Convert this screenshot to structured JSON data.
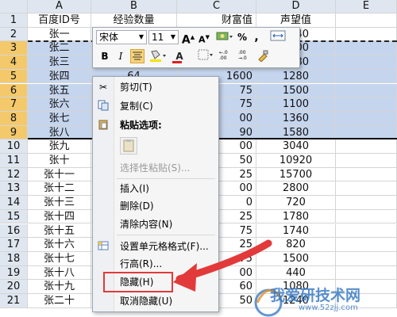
{
  "columns": {
    "A": "A",
    "B": "B",
    "C": "C",
    "D": "D",
    "E": "E"
  },
  "header_row": {
    "row": "1",
    "a": "百度ID号",
    "b": "经验数量",
    "c": "财富值",
    "d": "声望值"
  },
  "rows": [
    {
      "row": "2",
      "a": "张一",
      "b": "",
      "c": "",
      "d": "3040"
    },
    {
      "row": "3",
      "a": "张二",
      "b": "",
      "c": "",
      "d": "2400"
    },
    {
      "row": "4",
      "a": "张三",
      "b": "",
      "c": "",
      "d": "1980"
    },
    {
      "row": "5",
      "a": "张四",
      "b": "64",
      "c": "1600",
      "d": "1280"
    },
    {
      "row": "6",
      "a": "张五",
      "b": "",
      "c": "75",
      "d": "1500"
    },
    {
      "row": "7",
      "a": "张六",
      "b": "",
      "c": "75",
      "d": "1100"
    },
    {
      "row": "8",
      "a": "张七",
      "b": "",
      "c": "00",
      "d": "1360"
    },
    {
      "row": "9",
      "a": "张八",
      "b": "",
      "c": "90",
      "d": "1580"
    },
    {
      "row": "10",
      "a": "张九",
      "b": "",
      "c": "00",
      "d": "3040"
    },
    {
      "row": "11",
      "a": "张十",
      "b": "",
      "c": "50",
      "d": "10920"
    },
    {
      "row": "12",
      "a": "张十一",
      "b": "",
      "c": "25",
      "d": "15700"
    },
    {
      "row": "13",
      "a": "张十二",
      "b": "",
      "c": "00",
      "d": "2800"
    },
    {
      "row": "14",
      "a": "张十三",
      "b": "",
      "c": "0",
      "d": "720"
    },
    {
      "row": "15",
      "a": "张十四",
      "b": "",
      "c": "25",
      "d": "1780"
    },
    {
      "row": "16",
      "a": "张十五",
      "b": "",
      "c": "75",
      "d": "1740"
    },
    {
      "row": "17",
      "a": "张十六",
      "b": "",
      "c": "25",
      "d": "820"
    },
    {
      "row": "18",
      "a": "张十七",
      "b": "",
      "c": "75",
      "d": "1500"
    },
    {
      "row": "19",
      "a": "张十八",
      "b": "",
      "c": "00",
      "d": "440"
    },
    {
      "row": "20",
      "a": "张十九",
      "b": "",
      "c": "60",
      "d": "1080"
    },
    {
      "row": "21",
      "a": "张二十",
      "b": "",
      "c": "50",
      "d": "1240"
    }
  ],
  "mini_toolbar": {
    "font": "宋体",
    "size": "11",
    "grow": "A",
    "shrink": "A",
    "percent": "%",
    "comma": ",",
    "bold": "B",
    "italic": "I",
    "font_color_glyph": "A"
  },
  "menu": {
    "cut": "剪切(T)",
    "copy": "复制(C)",
    "paste_options": "粘贴选项:",
    "paste_special": "选择性粘贴(S)...",
    "insert": "插入(I)",
    "delete": "删除(D)",
    "clear": "清除内容(N)",
    "format_cells": "设置单元格格式(F)...",
    "row_height": "行高(R)...",
    "hide": "隐藏(H)",
    "unhide": "取消隐藏(U)"
  },
  "watermark": {
    "title": "我爱研技术网",
    "url": "www.52zjj.com"
  },
  "colors": {
    "selection": "#c5d5ee",
    "header": "#dfe6ef",
    "highlight": "#e23a3a"
  }
}
